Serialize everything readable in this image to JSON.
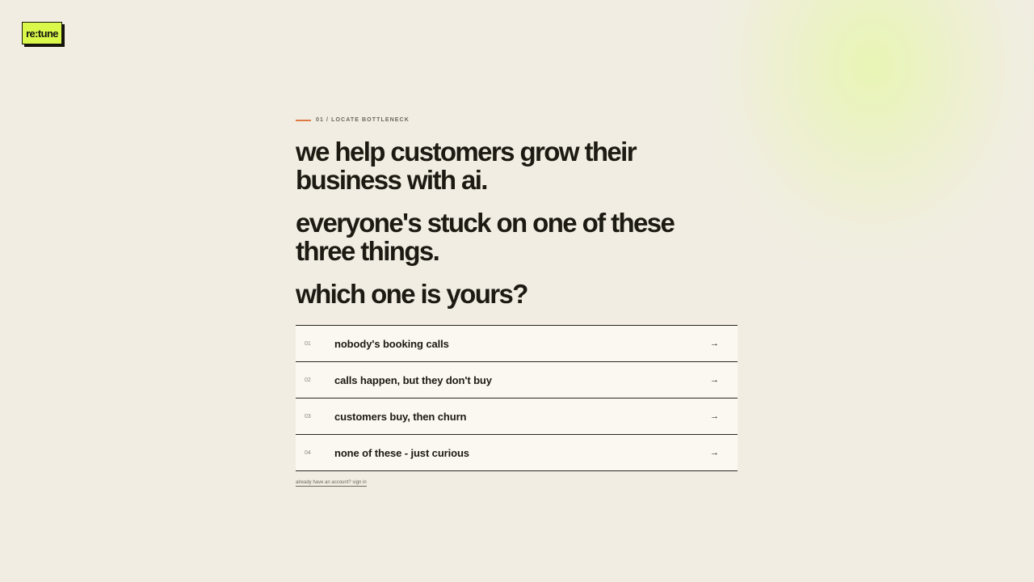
{
  "brand": {
    "logo_text": "re:tune",
    "accent_color": "#d9f84a",
    "eyebrow_color": "#e07a43"
  },
  "step": {
    "eyebrow": "01 / LOCATE BOTTLENECK"
  },
  "headlines": [
    "we help customers grow their business with ai.",
    "everyone's stuck on one of these three things.",
    "which one is yours?"
  ],
  "options": [
    {
      "number": "01",
      "label": "nobody's booking calls",
      "arrow": "→"
    },
    {
      "number": "02",
      "label": "calls happen, but they don't buy",
      "arrow": "→"
    },
    {
      "number": "03",
      "label": "customers buy, then churn",
      "arrow": "→"
    },
    {
      "number": "04",
      "label": "none of these - just curious",
      "arrow": "→"
    }
  ],
  "footer": {
    "signin_link": "already have an account? sign in"
  }
}
